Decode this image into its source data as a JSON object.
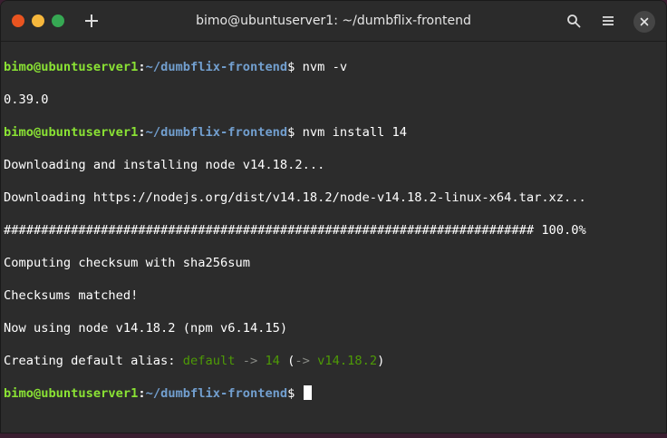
{
  "window": {
    "title": "bimo@ubuntuserver1: ~/dumbflix-frontend"
  },
  "prompt": {
    "user_host": "bimo@ubuntuserver1",
    "colon": ":",
    "path": "~/dumbflix-frontend",
    "dollar": "$ "
  },
  "lines": {
    "cmd1": "nvm -v",
    "out1": "0.39.0",
    "cmd2": "nvm install 14",
    "out2": "Downloading and installing node v14.18.2...",
    "out3": "Downloading https://nodejs.org/dist/v14.18.2/node-v14.18.2-linux-x64.tar.xz...",
    "out4": "####################################################################### 100.0%",
    "out5": "Computing checksum with sha256sum",
    "out6": "Checksums matched!",
    "out7": "Now using node v14.18.2 (npm v6.14.15)",
    "alias_prefix": "Creating default alias: ",
    "alias_name": "default",
    "alias_arrow1": " -> ",
    "alias_version": "14",
    "alias_paren_open": " (",
    "alias_arrow2": "-> ",
    "alias_full": "v14.18.2",
    "alias_paren_close": ")"
  },
  "icons": {
    "new_tab": "plus-icon",
    "search": "search-icon",
    "menu": "hamburger-menu-icon",
    "close": "close-icon"
  },
  "colors": {
    "close": "#e95420",
    "minimize": "#f6b73c",
    "maximize": "#36a853",
    "prompt_user": "#8ae234",
    "prompt_path": "#729fcf"
  }
}
